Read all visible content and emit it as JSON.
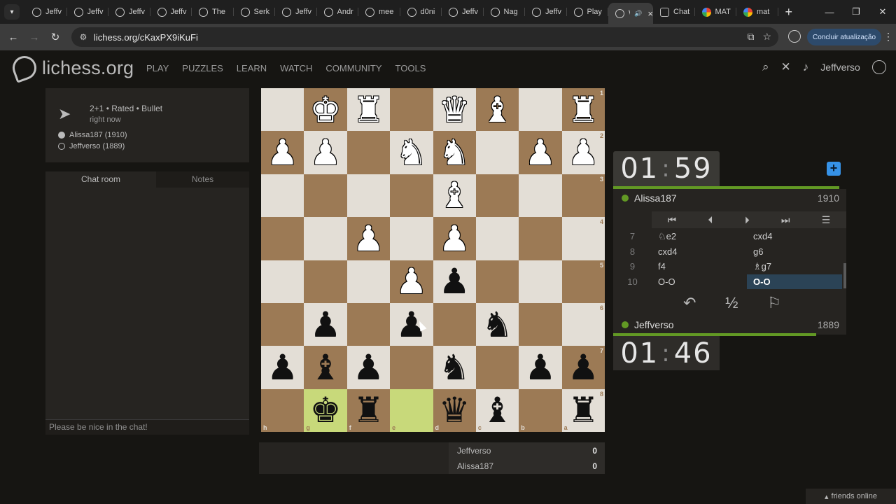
{
  "browser": {
    "tabs": [
      {
        "label": "Jeffv",
        "fav": "lichess"
      },
      {
        "label": "Jeffv",
        "fav": "lichess"
      },
      {
        "label": "Jeffv",
        "fav": "lichess"
      },
      {
        "label": "Jeffv",
        "fav": "lichess"
      },
      {
        "label": "The",
        "fav": "lichess"
      },
      {
        "label": "Serk",
        "fav": "lichess"
      },
      {
        "label": "Jeffv",
        "fav": "lichess"
      },
      {
        "label": "Andr",
        "fav": "lichess"
      },
      {
        "label": "mee",
        "fav": "lichess"
      },
      {
        "label": "d0ni",
        "fav": "lichess"
      },
      {
        "label": "Jeffv",
        "fav": "lichess"
      },
      {
        "label": "Nag",
        "fav": "lichess"
      },
      {
        "label": "Jeffv",
        "fav": "lichess"
      },
      {
        "label": "Play",
        "fav": "lichess"
      },
      {
        "label": "W",
        "fav": "lichess",
        "active": true
      },
      {
        "label": "Chat",
        "fav": "gpt"
      },
      {
        "label": "MAT",
        "fav": "google"
      },
      {
        "label": "mat",
        "fav": "google"
      }
    ],
    "url": "lichess.org/cKaxPX9iKuFi",
    "update_label": "Concluir atualização"
  },
  "site": {
    "logo": "lichess.org",
    "nav": [
      "PLAY",
      "PUZZLES",
      "LEARN",
      "WATCH",
      "COMMUNITY",
      "TOOLS"
    ],
    "username": "Jeffverso"
  },
  "game_info": {
    "type": "2+1 • Rated • Bullet",
    "time": "right now",
    "white_player": "Alissa187 (1910)",
    "black_player": "Jeffverso (1889)"
  },
  "chat": {
    "tab_chat": "Chat room",
    "tab_notes": "Notes",
    "placeholder": "Please be nice in the chat!"
  },
  "board": {
    "orientation": "black",
    "highlight": [
      "g8",
      "e8"
    ],
    "ranks_top_to_bottom": [
      [
        "",
        "wK",
        "wR",
        "",
        "wQ",
        "wB",
        "",
        "wR"
      ],
      [
        "wP",
        "wP",
        "",
        "wN",
        "wN",
        "",
        "wP",
        "wP"
      ],
      [
        "",
        "",
        "",
        "",
        "wB",
        "",
        "",
        ""
      ],
      [
        "",
        "",
        "wP",
        "",
        "wP",
        "",
        "",
        ""
      ],
      [
        "",
        "",
        "",
        "wP",
        "bP",
        "",
        "",
        ""
      ],
      [
        "",
        "bP",
        "",
        "bP",
        "",
        "bN",
        "",
        ""
      ],
      [
        "bP",
        "bB",
        "bP",
        "",
        "bN",
        "",
        "bP",
        "bP"
      ],
      [
        "",
        "bK",
        "bR",
        "",
        "bQ",
        "bB",
        "",
        "bR"
      ]
    ],
    "rank_labels": [
      "1",
      "2",
      "3",
      "4",
      "5",
      "6",
      "7",
      "8"
    ],
    "file_labels": [
      "h",
      "g",
      "f",
      "e",
      "d",
      "c",
      "b",
      "a"
    ]
  },
  "clocks": {
    "top": {
      "min": "01",
      "sec": "59",
      "bar_fraction": 0.97
    },
    "bottom": {
      "min": "01",
      "sec": "46",
      "bar_fraction": 0.87
    }
  },
  "players": {
    "top": {
      "name": "Alissa187",
      "rating": "1910"
    },
    "bottom": {
      "name": "Jeffverso",
      "rating": "1889"
    }
  },
  "moves": [
    {
      "no": "7",
      "white": "♘e2",
      "black": "cxd4"
    },
    {
      "no": "8",
      "white": "cxd4",
      "black": "g6"
    },
    {
      "no": "9",
      "white": "f4",
      "black": "♗g7"
    },
    {
      "no": "10",
      "white": "O-O",
      "black": "O-O",
      "current": "black"
    }
  ],
  "actions": {
    "draw": "½"
  },
  "crosstable": [
    {
      "name": "Jeffverso",
      "score": "0"
    },
    {
      "name": "Alissa187",
      "score": "0"
    }
  ],
  "friends": "friends online",
  "colors": {
    "accent_green": "#629924",
    "highlight": "#c8d97a",
    "link_blue": "#3692e7"
  }
}
